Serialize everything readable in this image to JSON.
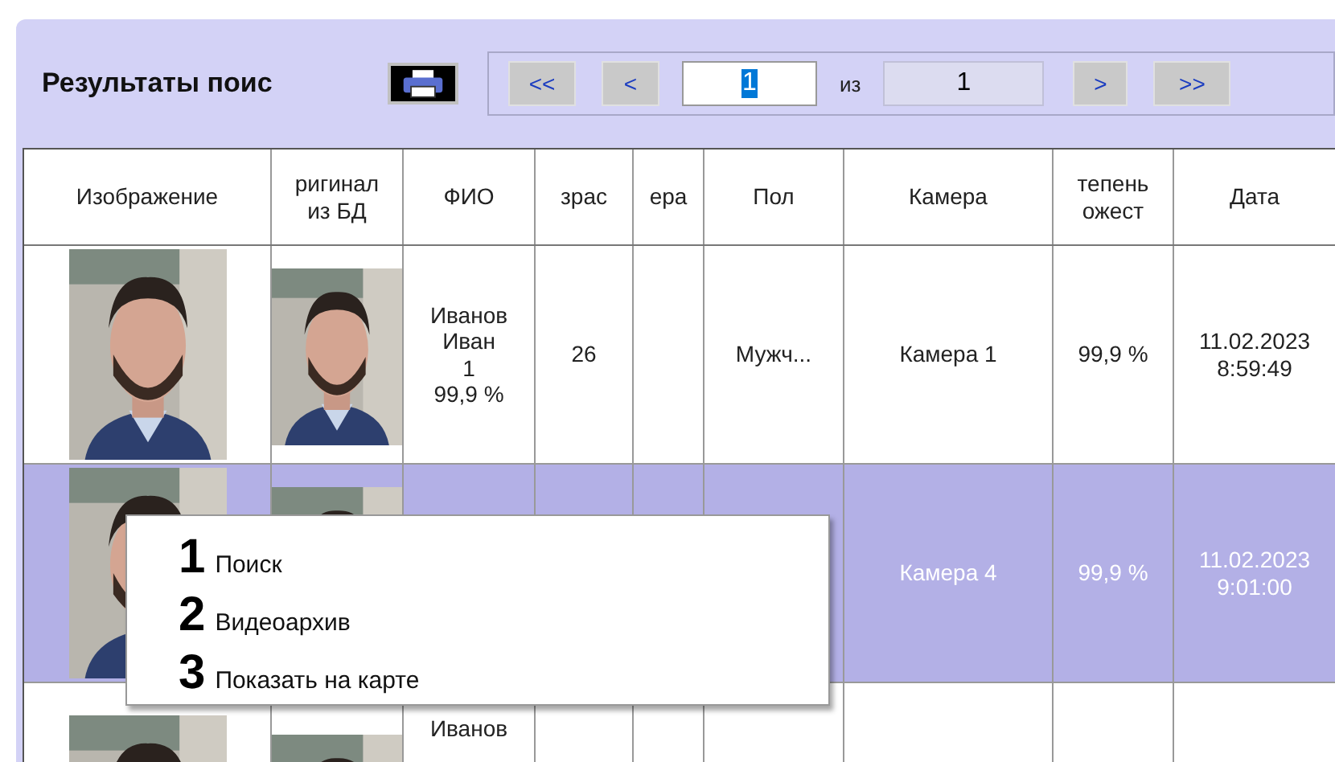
{
  "title": "Результаты поис",
  "pager": {
    "first": "<<",
    "prev": "<",
    "page": "1",
    "of": "из",
    "total": "1",
    "next": ">",
    "last": ">>"
  },
  "table": {
    "columns": [
      "Изображение",
      "ригинал\nиз БД",
      "ФИО",
      "зрас",
      "ера",
      "Пол",
      "Камера",
      "тепень\nожест",
      "Дата"
    ],
    "rows": [
      {
        "selected": false,
        "cells": [
          {
            "kind": "picture"
          },
          {
            "kind": "picture"
          },
          "Иванов\nИван\n1\n99,9 %",
          "26",
          "",
          "Мужч...",
          "Камера 1",
          "99,9 %",
          "11.02.2023\n8:59:49"
        ]
      },
      {
        "selected": true,
        "cells": [
          {
            "kind": "picture"
          },
          {
            "kind": "picture"
          },
          "",
          "",
          "",
          "",
          "Камера 4",
          "99,9 %",
          "11.02.2023\n9:01:00"
        ]
      },
      {
        "selected": false,
        "cells": [
          {
            "kind": "picture"
          },
          {
            "kind": "picture"
          },
          "Иванов",
          "",
          "",
          "",
          "",
          "",
          ""
        ]
      }
    ]
  },
  "context_menu": {
    "items": [
      {
        "number": "1",
        "label": "Поиск"
      },
      {
        "number": "2",
        "label": "Видеоархив"
      },
      {
        "number": "3",
        "label": "Показать на карте"
      }
    ]
  }
}
